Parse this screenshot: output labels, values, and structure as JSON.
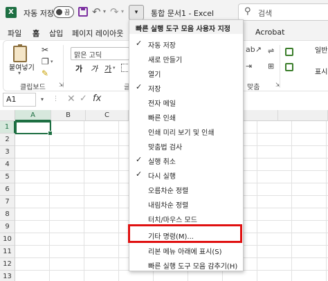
{
  "titlebar": {
    "autosave_label": "자동 저장",
    "autosave_state": "끔",
    "doc_title": "통합 문서1  -  Excel",
    "search_placeholder": "검색",
    "qat_button": "▾"
  },
  "tabs": [
    "파일",
    "홈",
    "삽입",
    "페이지 레이아웃"
  ],
  "tabs_right": [
    "Acrobat"
  ],
  "active_tab": "홈",
  "ribbon": {
    "paste_label": "붙여넣기",
    "font_name": "맑은 고딕",
    "bold": "가",
    "italic": "가",
    "underline": "가",
    "group_clipboard": "클립보드",
    "group_font_partial": "글",
    "group_align": "맞춤",
    "right_label_1": "일반",
    "right_label_2": "표시"
  },
  "formula_bar": {
    "namebox": "A1",
    "fx": "fx"
  },
  "grid": {
    "columns": [
      "A",
      "B",
      "C"
    ],
    "rows": [
      "1",
      "2",
      "3",
      "4",
      "5",
      "6",
      "7",
      "8",
      "9",
      "10",
      "11",
      "12",
      "13"
    ],
    "active_cell": "A1"
  },
  "menu": {
    "header": "빠른 실행 도구 모음 사용자 지정",
    "items": [
      {
        "label": "자동 저장",
        "checked": true
      },
      {
        "label": "새로 만들기",
        "checked": false
      },
      {
        "label": "열기",
        "checked": false
      },
      {
        "label": "저장",
        "checked": true
      },
      {
        "label": "전자 메일",
        "checked": false
      },
      {
        "label": "빠른 인쇄",
        "checked": false
      },
      {
        "label": "인쇄 미리 보기 및 인쇄",
        "checked": false
      },
      {
        "label": "맞춤법 검사",
        "checked": false
      },
      {
        "label": "실행 취소",
        "checked": true
      },
      {
        "label": "다시 실행",
        "checked": true
      },
      {
        "label": "오름차순 정렬",
        "checked": false
      },
      {
        "label": "내림차순 정렬",
        "checked": false
      },
      {
        "label": "터치/마우스 모드",
        "checked": false
      },
      {
        "label": "기타 명령(M)...",
        "checked": false
      },
      {
        "label": "리본 메뉴 아래에 표시(S)",
        "checked": false
      },
      {
        "label": "빠른 실행 도구 모음 감추기(H)",
        "checked": false
      }
    ],
    "highlighted_item": "기타 명령(M)...",
    "highlight_color": "#e01010"
  },
  "colors": {
    "excel_green": "#1d6f42",
    "titlebar_bg": "#f3f3f3"
  }
}
